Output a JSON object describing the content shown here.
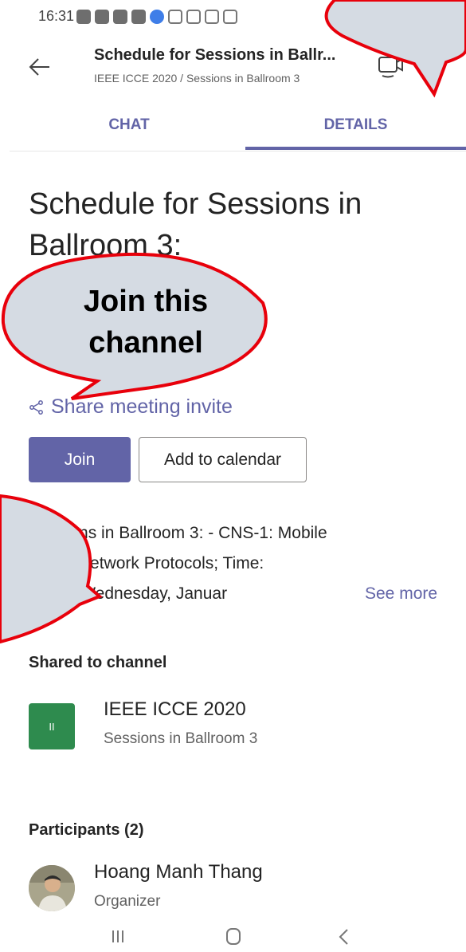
{
  "status_bar": {
    "time": "16:31",
    "notification_icons": [
      "zalo-icon",
      "vn-news-icon",
      "vn-news-icon",
      "vn-news-icon",
      "messenger-icon",
      "app-icon",
      "app-icon",
      "gmail-icon",
      "gallery-icon"
    ]
  },
  "header": {
    "title": "Schedule for Sessions in Ballr...",
    "subtitle": "IEEE ICCE 2020 / Sessions in Ballroom 3"
  },
  "tabs": [
    {
      "label": "CHAT",
      "active": false
    },
    {
      "label": "DETAILS",
      "active": true
    }
  ],
  "meeting": {
    "title": "Schedule for Sessions in Ballroom 3:",
    "share_invite_label": "Share meeting invite",
    "join_label": "Join",
    "add_calendar_label": "Add to calendar",
    "description_lines": [
      "Sessions in Ballroom 3: - CNS-1: Mobile",
      "reless Network Protocols; Time:",
      "17:45, Wednesday, Januar"
    ],
    "see_more_label": "See more"
  },
  "shared": {
    "section_title": "Shared to channel",
    "tile_text": "II",
    "team_name": "IEEE ICCE 2020",
    "channel_name": "Sessions in Ballroom 3"
  },
  "participants": {
    "section_title": "Participants (2)",
    "items": [
      {
        "name": "Hoang Manh Thang",
        "role": "Organizer"
      }
    ]
  },
  "callout": {
    "text_line1": "Join this",
    "text_line2": "channel"
  },
  "colors": {
    "accent": "#6264a7",
    "channel_tile": "#2e8b4e",
    "callout_fill": "#d5dbe3",
    "callout_stroke": "#e8000b"
  }
}
